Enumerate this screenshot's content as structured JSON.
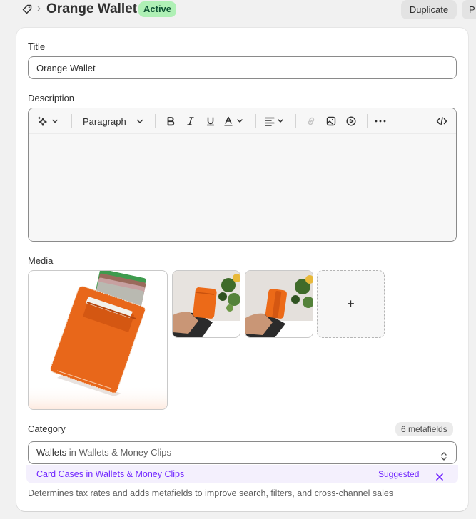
{
  "header": {
    "icon": "tag-icon",
    "separator": "›",
    "title": "Orange Wallet",
    "status": "Active",
    "duplicate_label": "Duplicate",
    "more_label": "P"
  },
  "form": {
    "title_label": "Title",
    "title_value": "Orange Wallet",
    "description_label": "Description",
    "toolbar": {
      "paragraph_label": "Paragraph"
    },
    "media_label": "Media",
    "add_media_label": "+",
    "category_label": "Category",
    "metafields_badge": "6 metafields",
    "category_value_primary": "Wallets",
    "category_value_secondary": " in Wallets & Money Clips",
    "suggestion_primary": "Card Cases",
    "suggestion_secondary": " in Wallets & Money Clips",
    "suggestion_tag": "Suggested",
    "helptext": "Determines tax rates and adds metafields to improve search, filters, and cross-channel sales"
  },
  "colors": {
    "status_bg": "#aff0b5",
    "status_text": "#0c5132",
    "suggest_accent": "#7126ff",
    "wallet_orange": "#e8671a"
  }
}
